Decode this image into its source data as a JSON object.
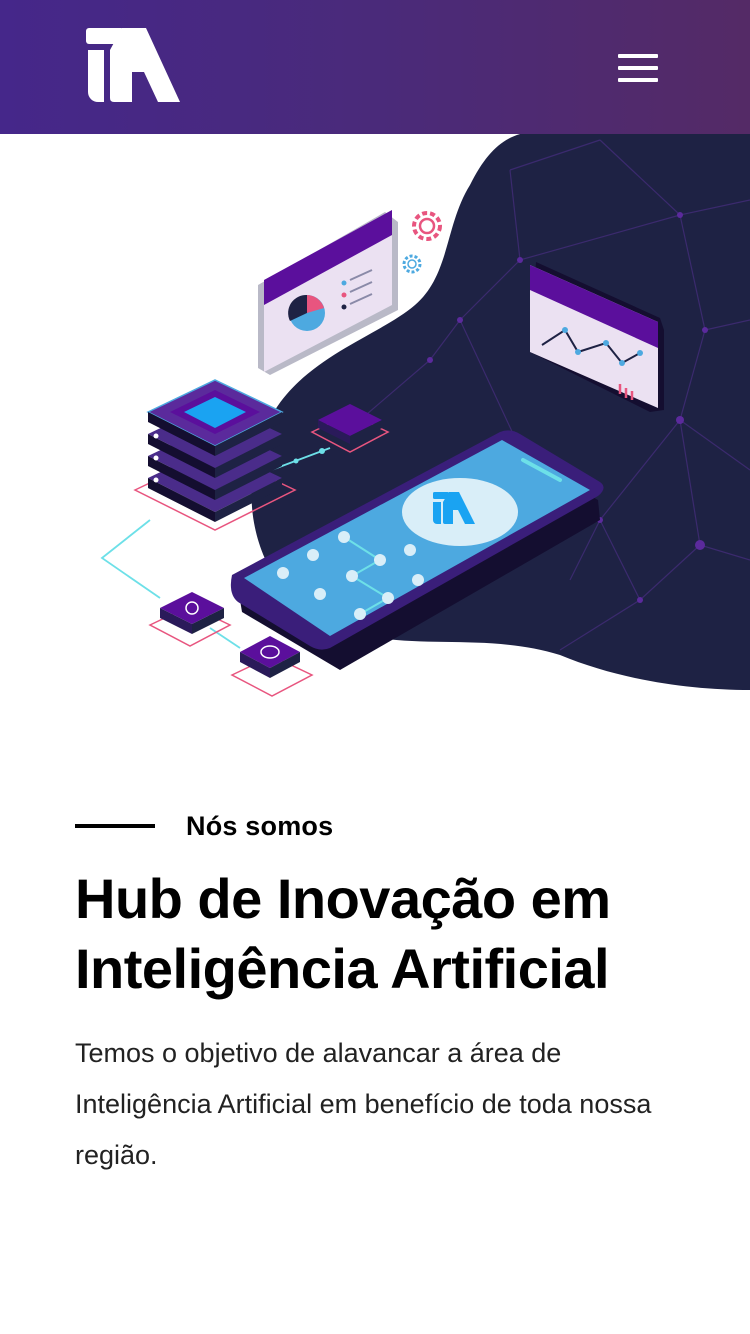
{
  "header": {
    "logo_name": "iA",
    "menu_icon": "hamburger-menu-icon",
    "gradient": [
      "#45278a",
      "#542a66"
    ]
  },
  "hero": {
    "illustration": "isometric-ai-hub-illustration",
    "blob_color": "#1e2244",
    "accent_purple": "#5b0f9c",
    "accent_blue": "#4da9e0",
    "accent_pink": "#e8557f"
  },
  "intro": {
    "eyebrow": "Nós somos",
    "title": "Hub de Inovação em Inteligência Artificial",
    "description": "Temos o objetivo de alavancar a área de Inteligência Artificial em benefício de toda nossa região."
  }
}
